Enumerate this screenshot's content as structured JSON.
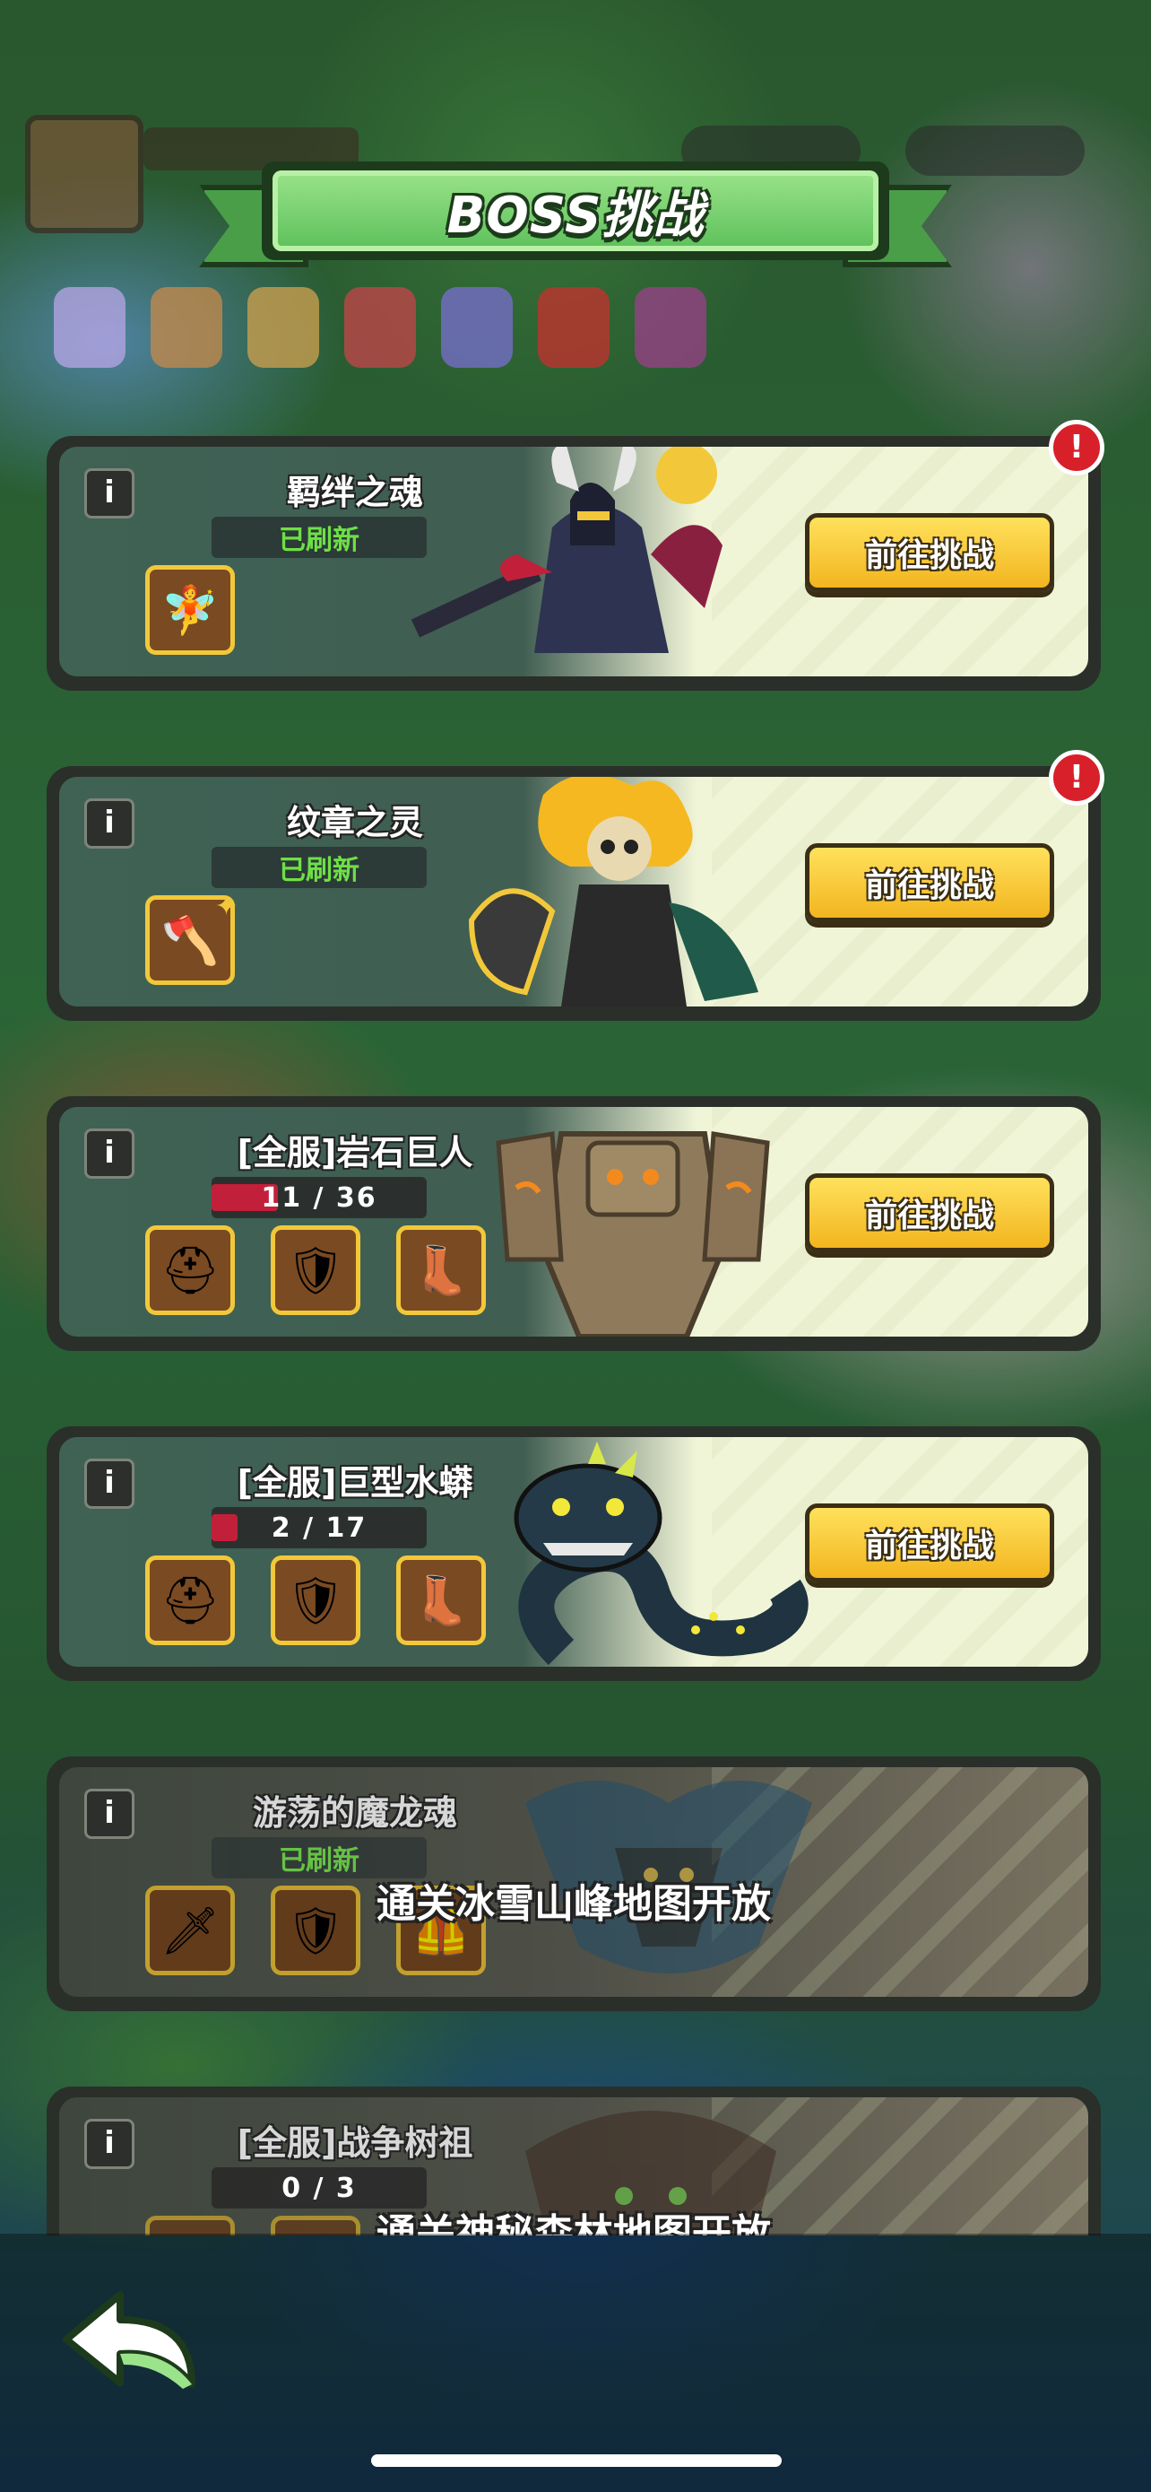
{
  "header": {
    "title": "BOSS挑战"
  },
  "colors": {
    "accent_green": "#5cc05a",
    "button_yellow": "#f2b51f",
    "refreshed_green": "#6ee046",
    "progress_red": "#c2203a",
    "alert_red": "#d8202a"
  },
  "bosses": [
    {
      "name": "羁绊之魂",
      "status": "已刷新",
      "button": "前往挑战",
      "alert": "!",
      "items": [
        {
          "icon": "fairy-icon",
          "glyph": "🧚"
        }
      ]
    },
    {
      "name": "纹章之灵",
      "status": "已刷新",
      "button": "前往挑战",
      "alert": "!",
      "items": [
        {
          "icon": "axe-icon",
          "glyph": "🪓"
        }
      ]
    },
    {
      "name": "[全服]岩石巨人",
      "progress_text": "11 / 36",
      "progress": 0.31,
      "button": "前往挑战",
      "items": [
        {
          "icon": "helmet-icon",
          "glyph": "⛑"
        },
        {
          "icon": "armor-icon",
          "glyph": "🛡"
        },
        {
          "icon": "boots-icon",
          "glyph": "👢"
        }
      ]
    },
    {
      "name": "[全服]巨型水蟒",
      "progress_text": "2 / 17",
      "progress": 0.12,
      "button": "前往挑战",
      "items": [
        {
          "icon": "helmet-icon",
          "glyph": "⛑"
        },
        {
          "icon": "armor-icon",
          "glyph": "🛡"
        },
        {
          "icon": "boots-icon",
          "glyph": "👢"
        }
      ]
    },
    {
      "name": "游荡的魔龙魂",
      "status": "已刷新",
      "locked_text": "通关冰雪山峰地图开放",
      "items": [
        {
          "icon": "sword-icon",
          "glyph": "🗡"
        },
        {
          "icon": "shield-icon",
          "glyph": "🛡"
        },
        {
          "icon": "chest-armor-icon",
          "glyph": "🦺"
        }
      ]
    },
    {
      "name": "[全服]战争树祖",
      "progress_text": "0 / 3",
      "progress": 0,
      "locked_text": "通关神秘森林地图开放",
      "items": []
    }
  ],
  "info_label": "i",
  "back_button": {
    "icon": "back-arrow-icon"
  }
}
